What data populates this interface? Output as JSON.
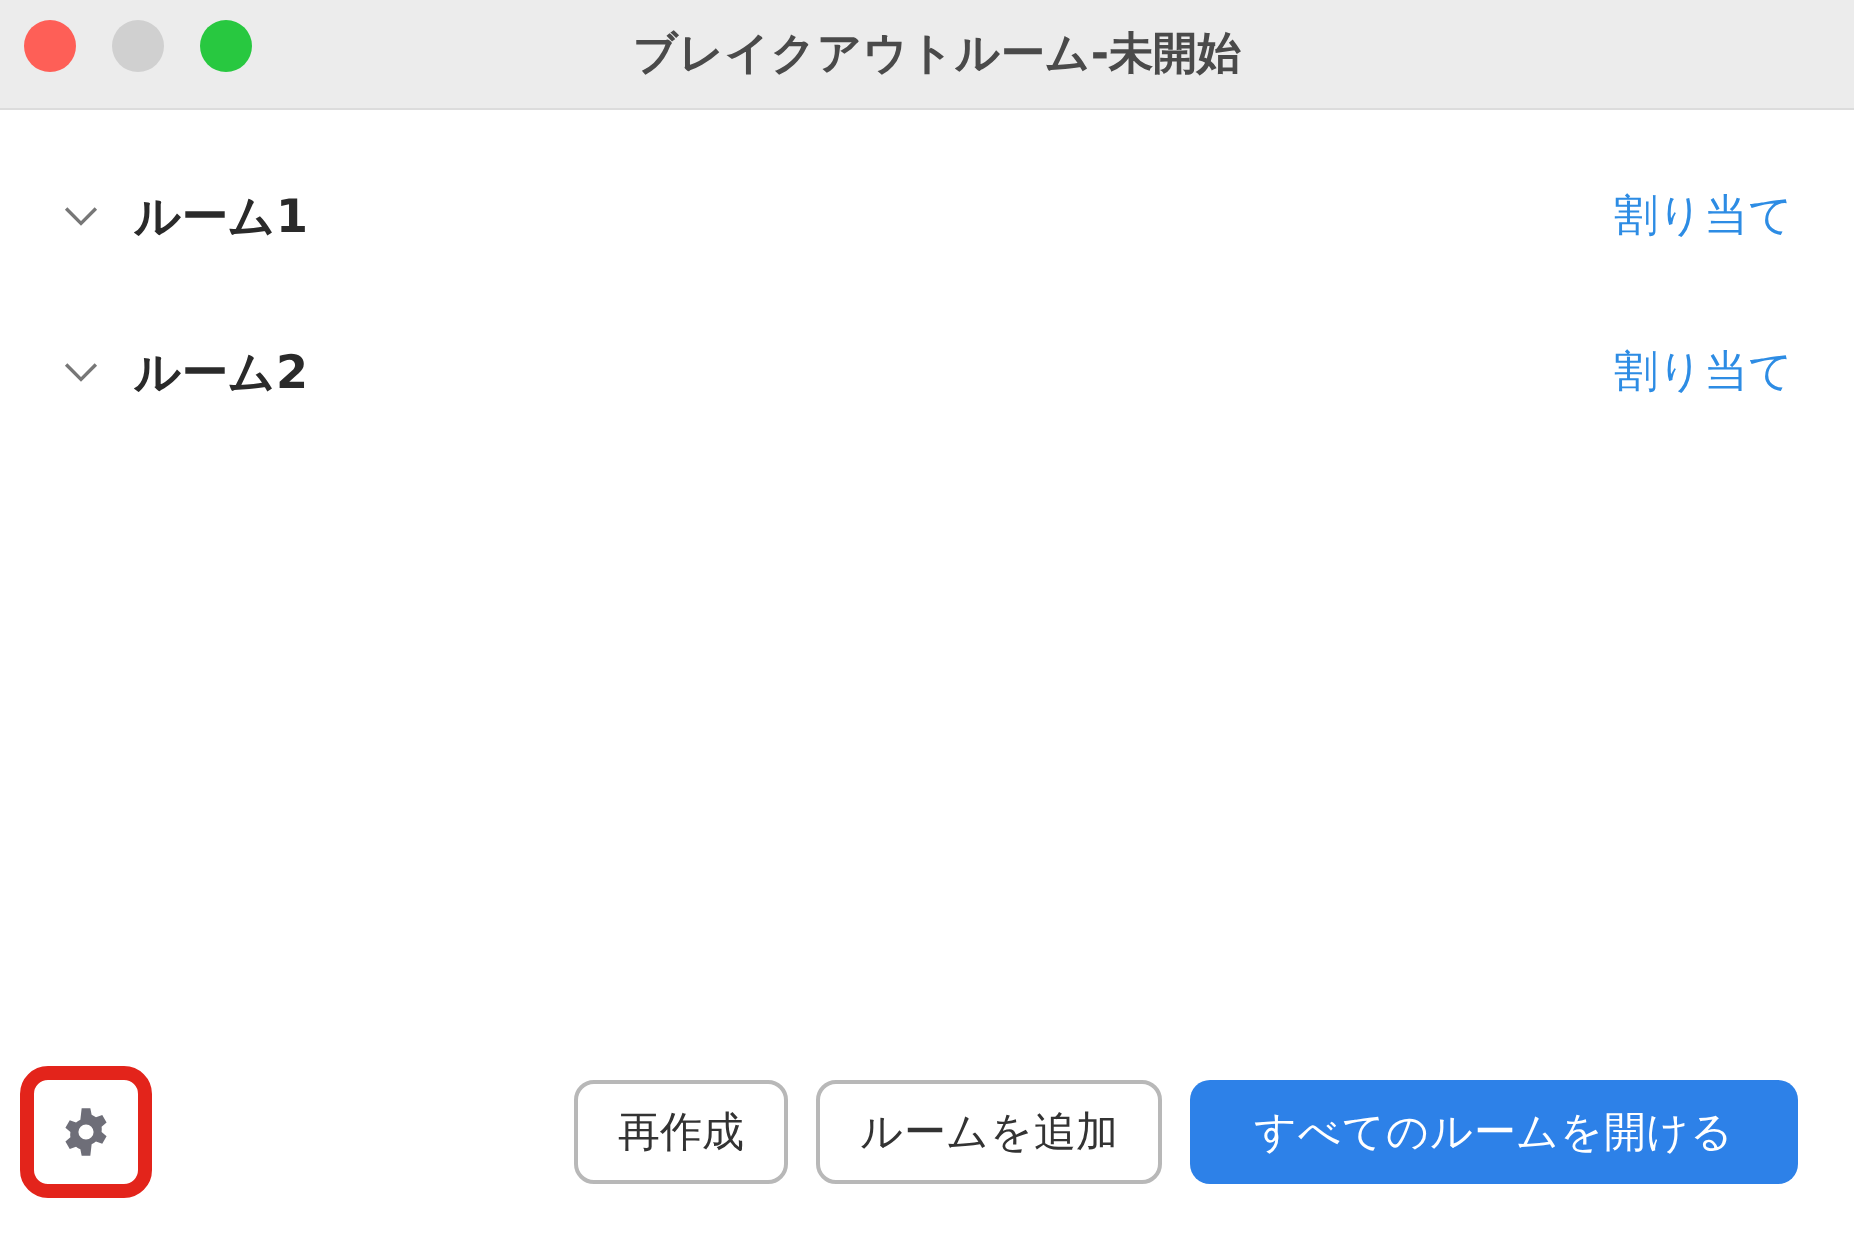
{
  "window": {
    "title": "ブレイクアウトルーム-未開始"
  },
  "rooms": [
    {
      "name": "ルーム1",
      "action": "割り当て"
    },
    {
      "name": "ルーム2",
      "action": "割り当て"
    }
  ],
  "settings": {
    "highlighted": true
  },
  "buttons": [
    {
      "label": "再作成",
      "kind": "secondary"
    },
    {
      "label": "ルームを追加",
      "kind": "secondary"
    },
    {
      "label": "すべてのルームを開ける",
      "kind": "primary"
    }
  ]
}
